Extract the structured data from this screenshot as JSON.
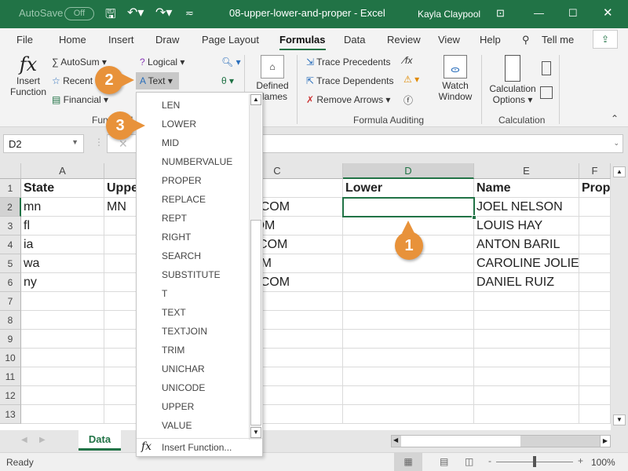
{
  "titlebar": {
    "autosave": "AutoSave",
    "autosave_state": "Off",
    "doc_title": "08-upper-lower-and-proper  -  Excel",
    "user": "Kayla Claypool"
  },
  "menu_tabs": [
    "File",
    "Home",
    "Insert",
    "Draw",
    "Page Layout",
    "Formulas",
    "Data",
    "Review",
    "View",
    "Help",
    "Tell me"
  ],
  "active_tab": "Formulas",
  "ribbon": {
    "insert_function": [
      "Insert",
      "Function"
    ],
    "autosum": "AutoSum",
    "recent": "Recent",
    "financial": "Financial",
    "logical": "Logical",
    "text": "Text",
    "defined_names": [
      "Defined",
      "Names"
    ],
    "trace_precedents": "Trace Precedents",
    "trace_dependents": "Trace Dependents",
    "remove_arrows": "Remove Arrows",
    "watch_window": [
      "Watch",
      "Window"
    ],
    "calc_options": [
      "Calculation",
      "Options"
    ],
    "groups": {
      "function_library": "Function Library",
      "formula_auditing": "Formula Auditing",
      "calculation": "Calculation"
    }
  },
  "name_box": "D2",
  "columns": [
    "A",
    "B",
    "C",
    "D",
    "E",
    "F"
  ],
  "rows": [
    "1",
    "2",
    "3",
    "4",
    "5",
    "6",
    "7",
    "8",
    "9",
    "10",
    "11",
    "12",
    "13"
  ],
  "cells": [
    [
      "State",
      "Upper",
      "",
      "Lower",
      "Name",
      "Proper"
    ],
    [
      "mn",
      "MN",
      "NASEA.COM",
      "",
      "JOEL NELSON",
      ""
    ],
    [
      "fl",
      "",
      "IALU.COM",
      "",
      "LOUIS HAY",
      ""
    ],
    [
      "ia",
      "",
      "LBASE.COM",
      "",
      "ANTON BARIL",
      ""
    ],
    [
      "wa",
      "",
      "ALU.COM",
      "",
      "CAROLINE JOLIE",
      ""
    ],
    [
      "ny",
      "",
      "NASEA.COM",
      "",
      "DANIEL RUIZ",
      ""
    ]
  ],
  "dropdown": {
    "items": [
      "LEN",
      "LOWER",
      "MID",
      "NUMBERVALUE",
      "PROPER",
      "REPLACE",
      "REPT",
      "RIGHT",
      "SEARCH",
      "SUBSTITUTE",
      "T",
      "TEXT",
      "TEXTJOIN",
      "TRIM",
      "UNICHAR",
      "UNICODE",
      "UPPER",
      "VALUE"
    ],
    "insert_function": "Insert Function..."
  },
  "sheet_tab": "Data",
  "status": {
    "ready": "Ready",
    "zoom": "100%"
  },
  "callouts": [
    "1",
    "2",
    "3"
  ],
  "colors": {
    "excel_green": "#217346",
    "callout": "#e8923a"
  }
}
